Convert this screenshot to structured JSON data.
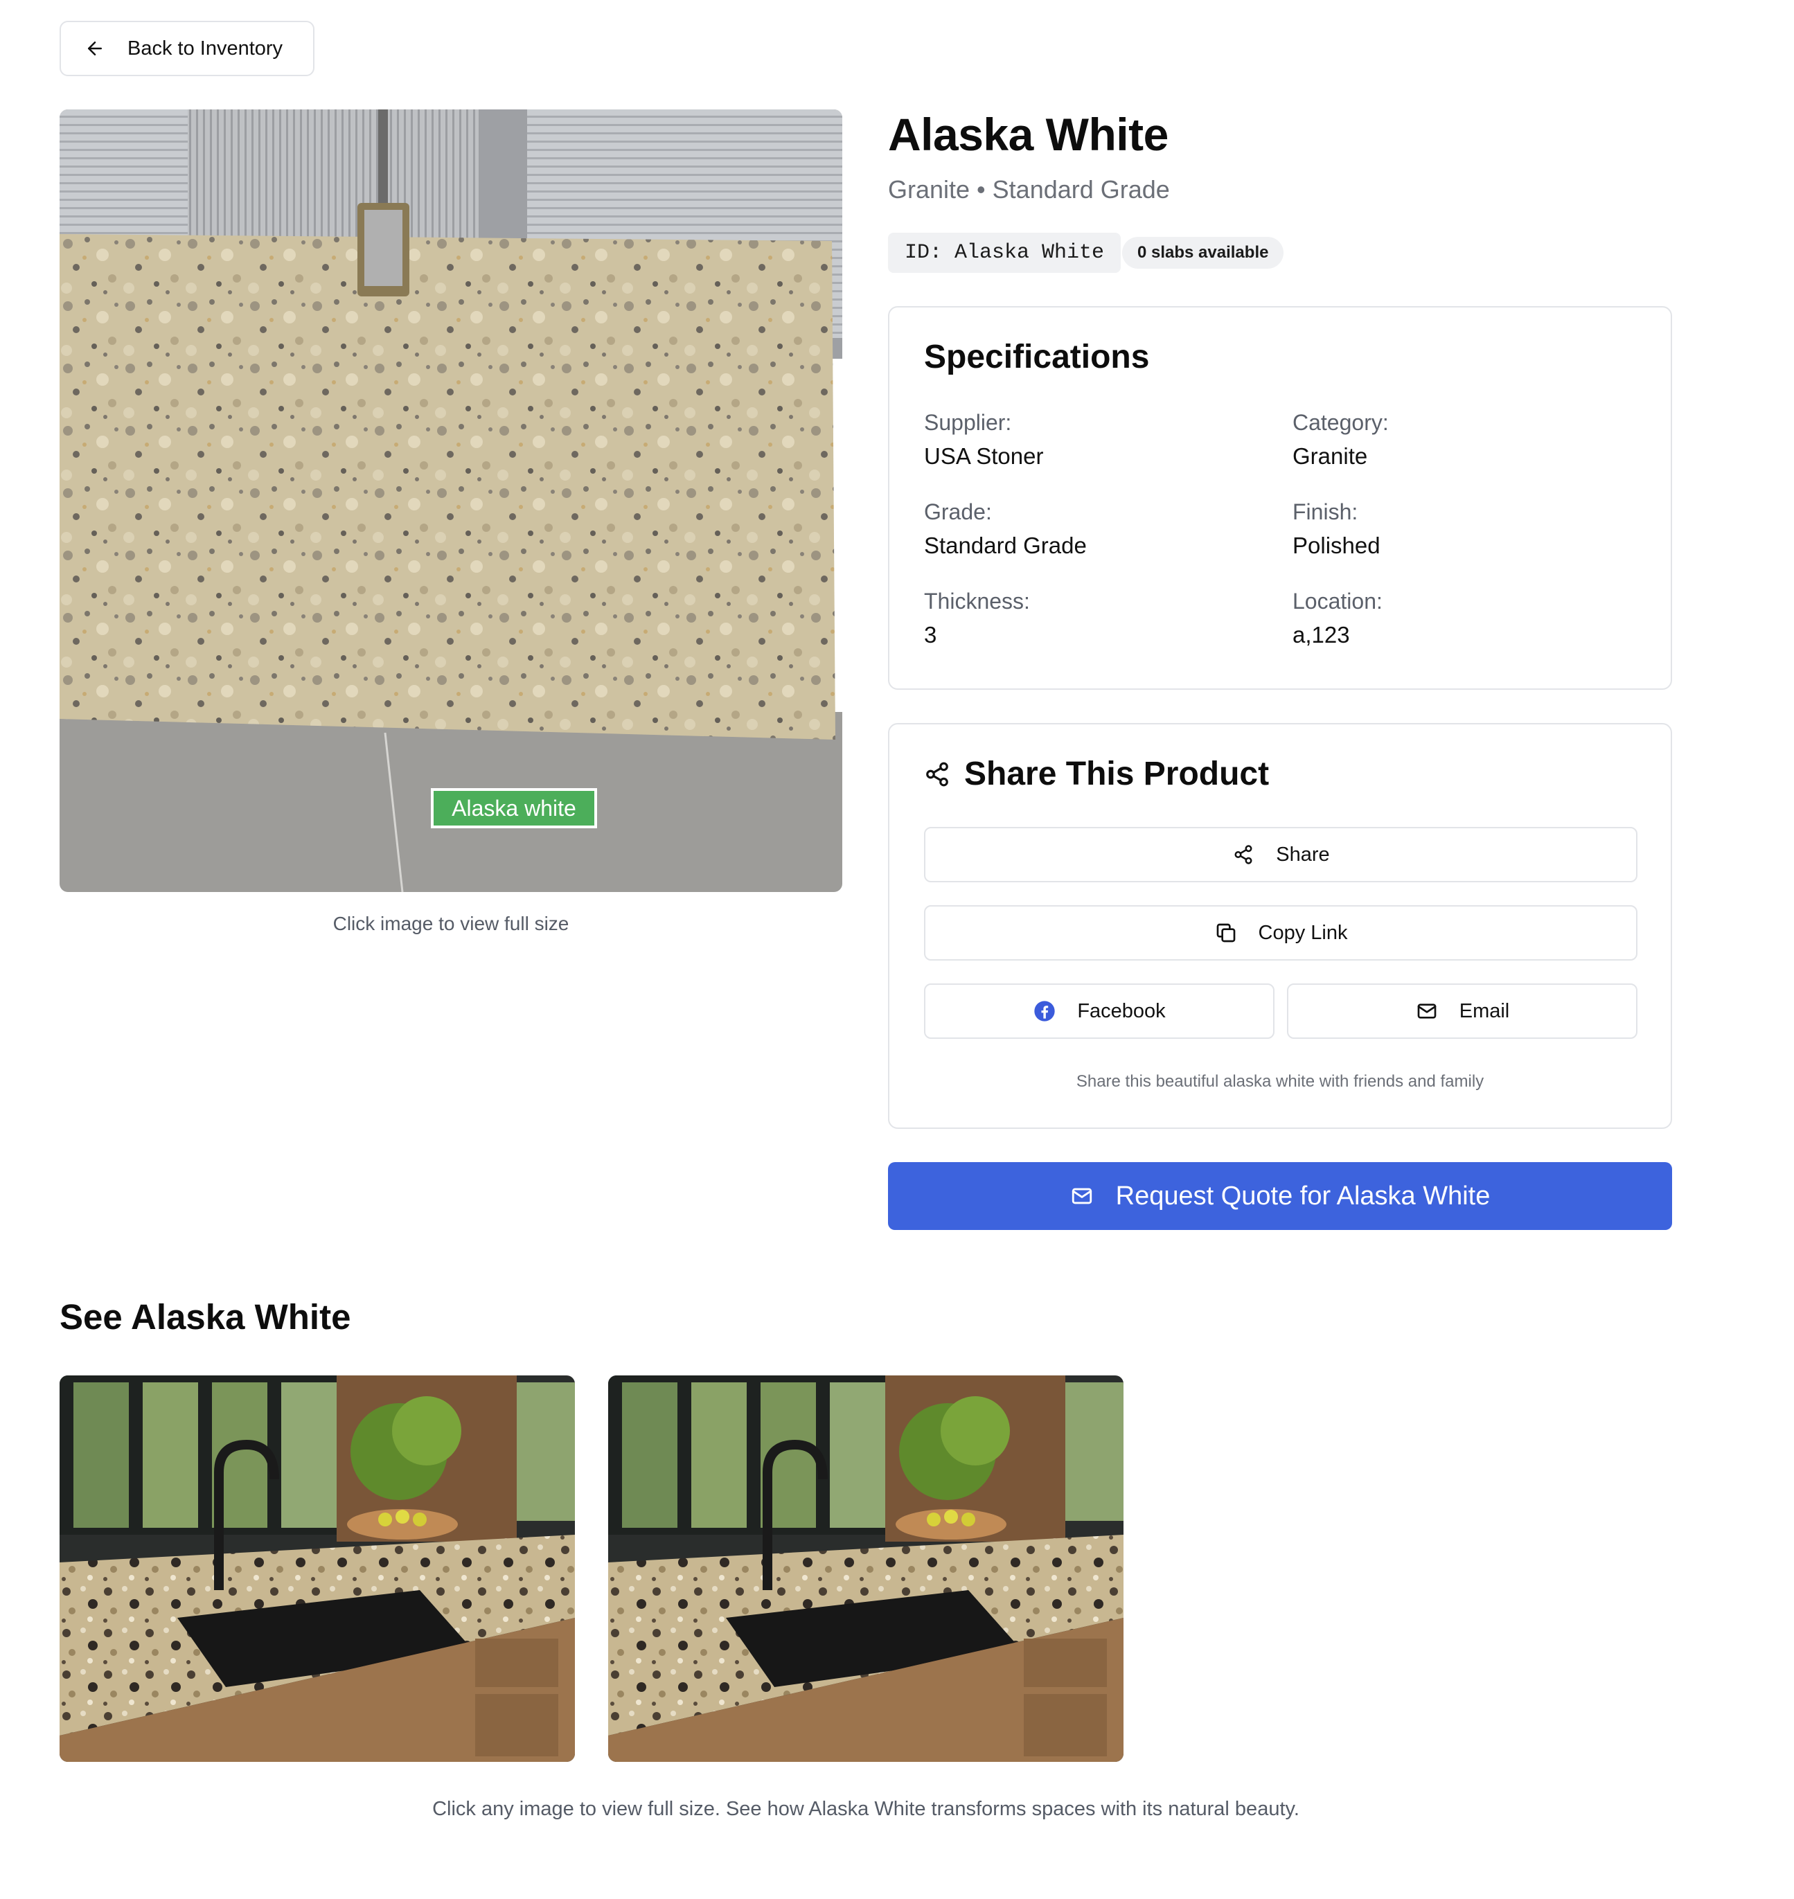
{
  "nav": {
    "back_label": "Back to Inventory"
  },
  "product": {
    "name": "Alaska White",
    "subtitle": "Granite • Standard Grade",
    "id_badge": "ID: Alaska White",
    "availability": "0 slabs available",
    "image_label": "Alaska white",
    "image_caption": "Click image to view full size"
  },
  "specs": {
    "title": "Specifications",
    "items": [
      {
        "label": "Supplier:",
        "value": "USA Stoner"
      },
      {
        "label": "Category:",
        "value": "Granite"
      },
      {
        "label": "Grade:",
        "value": "Standard Grade"
      },
      {
        "label": "Finish:",
        "value": "Polished"
      },
      {
        "label": "Thickness:",
        "value": "3"
      },
      {
        "label": "Location:",
        "value": "a,123"
      }
    ]
  },
  "share": {
    "title": "Share This Product",
    "share_label": "Share",
    "copy_label": "Copy Link",
    "facebook_label": "Facebook",
    "email_label": "Email",
    "note": "Share this beautiful alaska white with friends and family"
  },
  "quote": {
    "label": "Request Quote for Alaska White"
  },
  "gallery": {
    "title": "See Alaska White",
    "caption": "Click any image to view full size. See how Alaska White transforms spaces with its natural beauty."
  },
  "colors": {
    "accent": "#3d63dd",
    "facebook": "#3b5bdb",
    "label_green": "#4cae5a",
    "border": "#e2e4e8"
  },
  "icons": {
    "back": "arrow-left-icon",
    "share": "share-nodes-icon",
    "copy": "copy-icon",
    "facebook": "facebook-icon",
    "email": "mail-icon"
  }
}
